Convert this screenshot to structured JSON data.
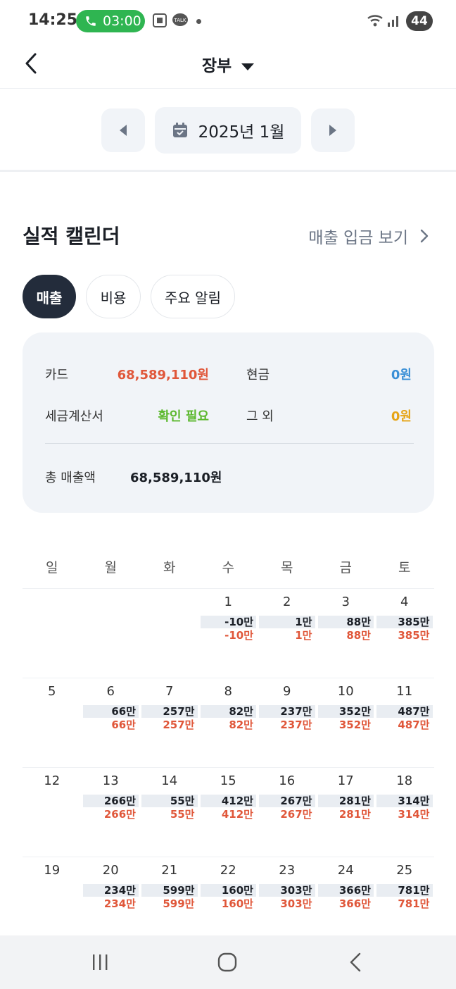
{
  "status_bar": {
    "time": "14:25",
    "call_timer": "03:00",
    "battery": "44",
    "icons": [
      "screenshot-icon",
      "talk-icon",
      "wifi-icon",
      "signal-icon"
    ],
    "call_color": "#2fb551"
  },
  "header": {
    "title": "장부",
    "back_icon": "chevron-left-icon",
    "dropdown_icon": "caret-down-icon"
  },
  "month_picker": {
    "label": "2025년 1월",
    "icon": "calendar-icon"
  },
  "section": {
    "title": "실적 캘린더",
    "link": "매출 입금 보기"
  },
  "chips": [
    {
      "label": "매출",
      "active": true
    },
    {
      "label": "비용",
      "active": false
    },
    {
      "label": "주요 알림",
      "active": false
    }
  ],
  "summary": {
    "card_label": "카드",
    "card_value": "68,589,110원",
    "cash_label": "현금",
    "cash_value": "0원",
    "tax_label": "세금계산서",
    "tax_value": "확인 필요",
    "other_label": "그 외",
    "other_value": "0원",
    "total_label": "총 매출액",
    "total_value": "68,589,110원",
    "colors": {
      "card": "#e0573a",
      "cash": "#3a8fd6",
      "tax": "#5cb82e",
      "other": "#e6a416"
    }
  },
  "calendar": {
    "weekdays": [
      "일",
      "월",
      "화",
      "수",
      "목",
      "금",
      "토"
    ],
    "weeks": [
      [
        {
          "day": "",
          "a": "",
          "b": ""
        },
        {
          "day": "",
          "a": "",
          "b": ""
        },
        {
          "day": "",
          "a": "",
          "b": ""
        },
        {
          "day": "1",
          "a": "-10만",
          "b": "-10만"
        },
        {
          "day": "2",
          "a": "1만",
          "b": "1만"
        },
        {
          "day": "3",
          "a": "88만",
          "b": "88만"
        },
        {
          "day": "4",
          "a": "385만",
          "b": "385만"
        }
      ],
      [
        {
          "day": "5",
          "a": "",
          "b": ""
        },
        {
          "day": "6",
          "a": "66만",
          "b": "66만"
        },
        {
          "day": "7",
          "a": "257만",
          "b": "257만"
        },
        {
          "day": "8",
          "a": "82만",
          "b": "82만"
        },
        {
          "day": "9",
          "a": "237만",
          "b": "237만"
        },
        {
          "day": "10",
          "a": "352만",
          "b": "352만"
        },
        {
          "day": "11",
          "a": "487만",
          "b": "487만"
        }
      ],
      [
        {
          "day": "12",
          "a": "",
          "b": ""
        },
        {
          "day": "13",
          "a": "266만",
          "b": "266만"
        },
        {
          "day": "14",
          "a": "55만",
          "b": "55만"
        },
        {
          "day": "15",
          "a": "412만",
          "b": "412만"
        },
        {
          "day": "16",
          "a": "267만",
          "b": "267만"
        },
        {
          "day": "17",
          "a": "281만",
          "b": "281만"
        },
        {
          "day": "18",
          "a": "314만",
          "b": "314만"
        }
      ],
      [
        {
          "day": "19",
          "a": "",
          "b": ""
        },
        {
          "day": "20",
          "a": "234만",
          "b": "234만"
        },
        {
          "day": "21",
          "a": "599만",
          "b": "599만"
        },
        {
          "day": "22",
          "a": "160만",
          "b": "160만"
        },
        {
          "day": "23",
          "a": "303만",
          "b": "303만"
        },
        {
          "day": "24",
          "a": "366만",
          "b": "366만"
        },
        {
          "day": "25",
          "a": "781만",
          "b": "781만"
        }
      ]
    ]
  },
  "nav_bar": {
    "icons": [
      "recents-icon",
      "home-icon",
      "back-icon"
    ]
  }
}
